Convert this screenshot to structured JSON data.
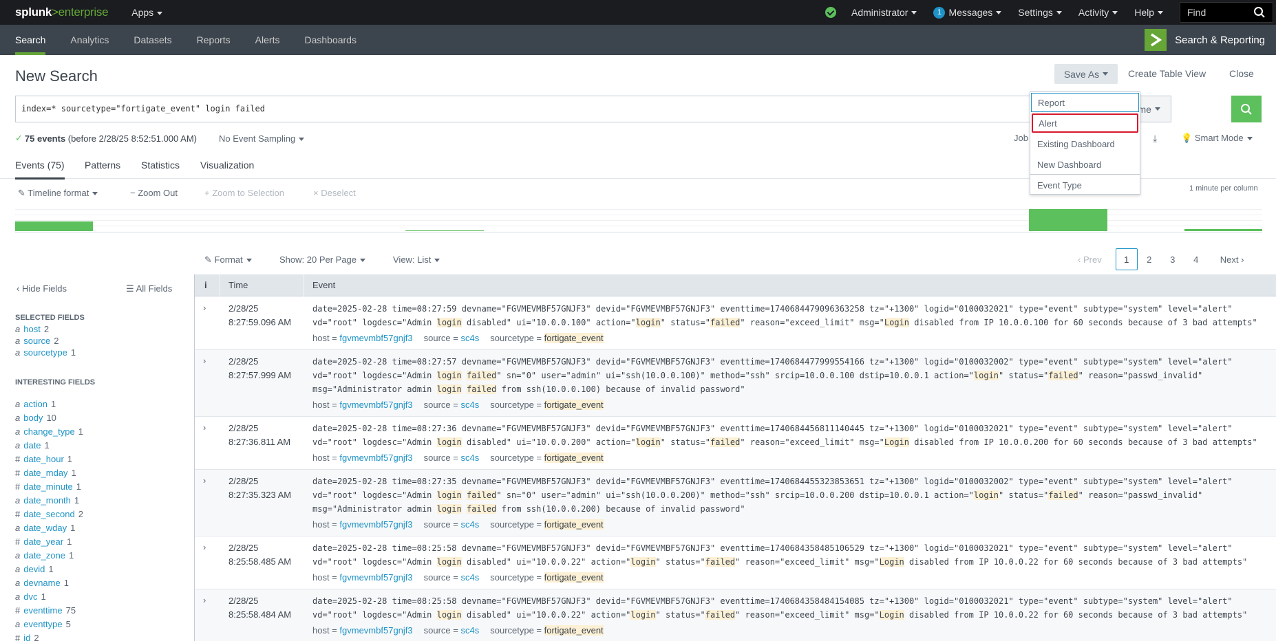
{
  "topbar": {
    "logo_main": "splunk",
    "logo_gt": ">",
    "logo_sub": "enterprise",
    "apps": "Apps",
    "user": "Administrator",
    "messages_count": "1",
    "messages": "Messages",
    "settings": "Settings",
    "activity": "Activity",
    "help": "Help",
    "find_placeholder": "Find"
  },
  "appbar": {
    "tabs": [
      "Search",
      "Analytics",
      "Datasets",
      "Reports",
      "Alerts",
      "Dashboards"
    ],
    "active_tab": "Search",
    "app_name": "Search & Reporting"
  },
  "header": {
    "title": "New Search",
    "save_as": "Save As",
    "create_table_view": "Create Table View",
    "close": "Close"
  },
  "search": {
    "query": "index=* sourcetype=\"fortigate_event\" login failed",
    "time_range": "All time"
  },
  "status": {
    "events_count": "75 events",
    "events_note": "(before 2/28/25 8:52:51.000 AM)",
    "sampling": "No Event Sampling",
    "job": "Job",
    "mode": "Smart Mode"
  },
  "tabs": [
    "Events (75)",
    "Patterns",
    "Statistics",
    "Visualization"
  ],
  "timeline": {
    "format": "Timeline format",
    "zoom_out": "Zoom Out",
    "zoom_selection": "Zoom to Selection",
    "deselect": "Deselect",
    "scale": "1 minute per column"
  },
  "results_controls": {
    "format": "Format",
    "per_page": "Show: 20 Per Page",
    "view": "View: List",
    "prev": "Prev",
    "pages": [
      "1",
      "2",
      "3",
      "4"
    ],
    "current_page": "1",
    "next": "Next"
  },
  "sidebar": {
    "hide_fields": "Hide Fields",
    "all_fields": "All Fields",
    "selected_title": "SELECTED FIELDS",
    "selected": [
      {
        "type": "a",
        "name": "host",
        "count": "2"
      },
      {
        "type": "a",
        "name": "source",
        "count": "2"
      },
      {
        "type": "a",
        "name": "sourcetype",
        "count": "1"
      }
    ],
    "interesting_title": "INTERESTING FIELDS",
    "interesting": [
      {
        "type": "a",
        "name": "action",
        "count": "1"
      },
      {
        "type": "a",
        "name": "body",
        "count": "10"
      },
      {
        "type": "a",
        "name": "change_type",
        "count": "1"
      },
      {
        "type": "a",
        "name": "date",
        "count": "1"
      },
      {
        "type": "#",
        "name": "date_hour",
        "count": "1"
      },
      {
        "type": "#",
        "name": "date_mday",
        "count": "1"
      },
      {
        "type": "#",
        "name": "date_minute",
        "count": "1"
      },
      {
        "type": "a",
        "name": "date_month",
        "count": "1"
      },
      {
        "type": "#",
        "name": "date_second",
        "count": "2"
      },
      {
        "type": "a",
        "name": "date_wday",
        "count": "1"
      },
      {
        "type": "#",
        "name": "date_year",
        "count": "1"
      },
      {
        "type": "a",
        "name": "date_zone",
        "count": "1"
      },
      {
        "type": "a",
        "name": "devid",
        "count": "1"
      },
      {
        "type": "a",
        "name": "devname",
        "count": "1"
      },
      {
        "type": "a",
        "name": "dvc",
        "count": "1"
      },
      {
        "type": "#",
        "name": "eventtime",
        "count": "75"
      },
      {
        "type": "a",
        "name": "eventtype",
        "count": "5"
      },
      {
        "type": "#",
        "name": "id",
        "count": "2"
      }
    ]
  },
  "table": {
    "col_i": "i",
    "col_time": "Time",
    "col_event": "Event",
    "meta_labels": {
      "host": "host =",
      "source": "source =",
      "sourcetype": "sourcetype ="
    },
    "rows": [
      {
        "date": "2/28/25",
        "time": "8:27:59.096 AM",
        "event": [
          [
            "date=2025-02-28 time=08:27:59 devname=\"FGVMEVMBF57GNJF3\" devid=\"FGVMEVMBF57GNJF3\" eventtime=1740684479096363258 tz=\"+1300\" logid=\"0100032021\" type=\"event\" subtype=\"system\" level=\"alert\" vd=\"root\" logdesc=\"Admin ",
            0
          ],
          [
            "login",
            1
          ],
          [
            " disabled\" ui=\"10.0.0.100\" action=\"",
            0
          ],
          [
            "login",
            1
          ],
          [
            "\" status=\"",
            0
          ],
          [
            "failed",
            1
          ],
          [
            "\" reason=\"exceed_limit\" msg=\"",
            0
          ],
          [
            "Login",
            1
          ],
          [
            " disabled from IP 10.0.0.100 for 60 seconds because of 3 bad attempts\"",
            0
          ]
        ],
        "host": "fgvmevmbf57gnjf3",
        "source": "sc4s",
        "sourcetype": "fortigate_event"
      },
      {
        "date": "2/28/25",
        "time": "8:27:57.999 AM",
        "event": [
          [
            "date=2025-02-28 time=08:27:57 devname=\"FGVMEVMBF57GNJF3\" devid=\"FGVMEVMBF57GNJF3\" eventtime=1740684477999554166 tz=\"+1300\" logid=\"0100032002\" type=\"event\" subtype=\"system\" level=\"alert\" vd=\"root\" logdesc=\"Admin ",
            0
          ],
          [
            "login",
            1
          ],
          [
            " ",
            0
          ],
          [
            "failed",
            1
          ],
          [
            "\" sn=\"0\" user=\"admin\" ui=\"ssh(10.0.0.100)\" method=\"ssh\" srcip=10.0.0.100 dstip=10.0.0.1 action=\"",
            0
          ],
          [
            "login",
            1
          ],
          [
            "\" status=\"",
            0
          ],
          [
            "failed",
            1
          ],
          [
            "\" reason=\"passwd_invalid\" msg=\"Administrator admin ",
            0
          ],
          [
            "login",
            1
          ],
          [
            " ",
            0
          ],
          [
            "failed",
            1
          ],
          [
            " from ssh(10.0.0.100) because of invalid password\"",
            0
          ]
        ],
        "host": "fgvmevmbf57gnjf3",
        "source": "sc4s",
        "sourcetype": "fortigate_event"
      },
      {
        "date": "2/28/25",
        "time": "8:27:36.811 AM",
        "event": [
          [
            "date=2025-02-28 time=08:27:36 devname=\"FGVMEVMBF57GNJF3\" devid=\"FGVMEVMBF57GNJF3\" eventtime=1740684456811140445 tz=\"+1300\" logid=\"0100032021\" type=\"event\" subtype=\"system\" level=\"alert\" vd=\"root\" logdesc=\"Admin ",
            0
          ],
          [
            "login",
            1
          ],
          [
            " disabled\" ui=\"10.0.0.200\" action=\"",
            0
          ],
          [
            "login",
            1
          ],
          [
            "\" status=\"",
            0
          ],
          [
            "failed",
            1
          ],
          [
            "\" reason=\"exceed_limit\" msg=\"",
            0
          ],
          [
            "Login",
            1
          ],
          [
            " disabled from IP 10.0.0.200 for 60 seconds because of 3 bad attempts\"",
            0
          ]
        ],
        "host": "fgvmevmbf57gnjf3",
        "source": "sc4s",
        "sourcetype": "fortigate_event"
      },
      {
        "date": "2/28/25",
        "time": "8:27:35.323 AM",
        "event": [
          [
            "date=2025-02-28 time=08:27:35 devname=\"FGVMEVMBF57GNJF3\" devid=\"FGVMEVMBF57GNJF3\" eventtime=1740684455323853651 tz=\"+1300\" logid=\"0100032002\" type=\"event\" subtype=\"system\" level=\"alert\" vd=\"root\" logdesc=\"Admin ",
            0
          ],
          [
            "login",
            1
          ],
          [
            " ",
            0
          ],
          [
            "failed",
            1
          ],
          [
            "\" sn=\"0\" user=\"admin\" ui=\"ssh(10.0.0.200)\" method=\"ssh\" srcip=10.0.0.200 dstip=10.0.0.1 action=\"",
            0
          ],
          [
            "login",
            1
          ],
          [
            "\" status=\"",
            0
          ],
          [
            "failed",
            1
          ],
          [
            "\" reason=\"passwd_invalid\" msg=\"Administrator admin ",
            0
          ],
          [
            "login",
            1
          ],
          [
            " ",
            0
          ],
          [
            "failed",
            1
          ],
          [
            " from ssh(10.0.0.200) because of invalid password\"",
            0
          ]
        ],
        "host": "fgvmevmbf57gnjf3",
        "source": "sc4s",
        "sourcetype": "fortigate_event"
      },
      {
        "date": "2/28/25",
        "time": "8:25:58.485 AM",
        "event": [
          [
            "date=2025-02-28 time=08:25:58 devname=\"FGVMEVMBF57GNJF3\" devid=\"FGVMEVMBF57GNJF3\" eventtime=1740684358485106529 tz=\"+1300\" logid=\"0100032021\" type=\"event\" subtype=\"system\" level=\"alert\" vd=\"root\" logdesc=\"Admin ",
            0
          ],
          [
            "login",
            1
          ],
          [
            " disabled\" ui=\"10.0.0.22\" action=\"",
            0
          ],
          [
            "login",
            1
          ],
          [
            "\" status=\"",
            0
          ],
          [
            "failed",
            1
          ],
          [
            "\" reason=\"exceed_limit\" msg=\"",
            0
          ],
          [
            "Login",
            1
          ],
          [
            " disabled from IP 10.0.0.22 for 60 seconds because of 3 bad attempts\"",
            0
          ]
        ],
        "host": "fgvmevmbf57gnjf3",
        "source": "sc4s",
        "sourcetype": "fortigate_event"
      },
      {
        "date": "2/28/25",
        "time": "8:25:58.484 AM",
        "event": [
          [
            "date=2025-02-28 time=08:25:58 devname=\"FGVMEVMBF57GNJF3\" devid=\"FGVMEVMBF57GNJF3\" eventtime=1740684358484154085 tz=\"+1300\" logid=\"0100032021\" type=\"event\" subtype=\"system\" level=\"alert\" vd=\"root\" logdesc=\"Admin ",
            0
          ],
          [
            "login",
            1
          ],
          [
            " disabled\" ui=\"10.0.0.22\" action=\"",
            0
          ],
          [
            "login",
            1
          ],
          [
            "\" status=\"",
            0
          ],
          [
            "failed",
            1
          ],
          [
            "\" reason=\"exceed_limit\" msg=\"",
            0
          ],
          [
            "Login",
            1
          ],
          [
            " disabled from IP 10.0.0.22 for 60 seconds because of 3 bad attempts\"",
            0
          ]
        ],
        "host": "fgvmevmbf57gnjf3",
        "source": "sc4s",
        "sourcetype": "fortigate_event"
      }
    ]
  },
  "save_as_menu": {
    "items": [
      "Report",
      "Alert",
      "Existing Dashboard",
      "New Dashboard",
      "Event Type"
    ],
    "highlighted": "Alert"
  },
  "colors": {
    "accent_green": "#5cc05c",
    "link_blue": "#1e93c6",
    "highlight_red": "#d6182d",
    "term_highlight": "#fcf0d5"
  }
}
